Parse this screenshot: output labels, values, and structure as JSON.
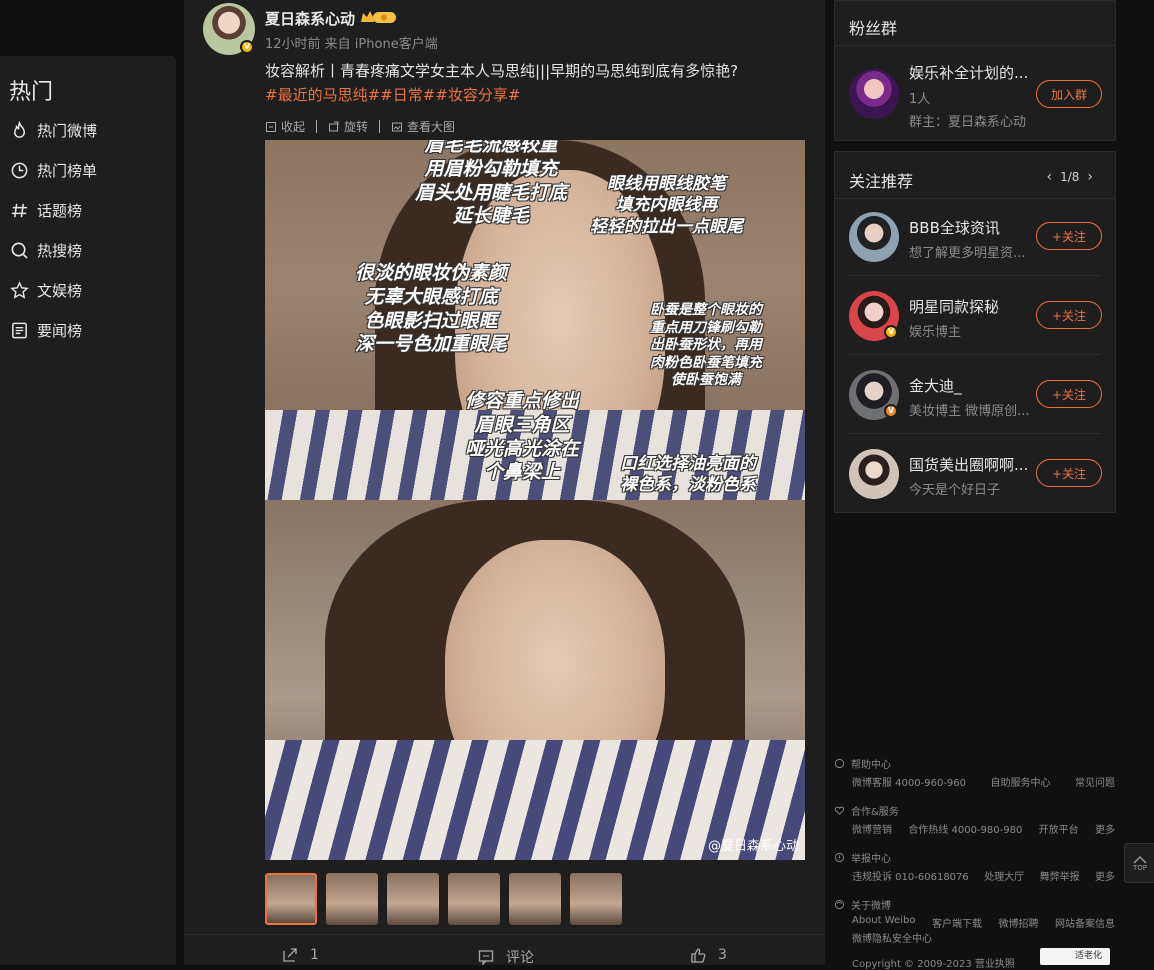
{
  "nav": {
    "title": "热门",
    "items": [
      {
        "label": "热门微博",
        "icon": "fire-icon"
      },
      {
        "label": "热门榜单",
        "icon": "clock-icon"
      },
      {
        "label": "话题榜",
        "icon": "hashtag-icon"
      },
      {
        "label": "热搜榜",
        "icon": "search-icon"
      },
      {
        "label": "文娱榜",
        "icon": "star-icon"
      },
      {
        "label": "要闻榜",
        "icon": "news-icon"
      }
    ]
  },
  "post": {
    "username": "夏日森系心动",
    "meta": "12小时前 来自 iPhone客户端",
    "text": "妆容解析丨青春疼痛文学女主本人马思纯|||早期的马思纯到底有多惊艳?",
    "tags": "#最近的马思纯##日常##妆容分享#",
    "toolbar": {
      "collapse": "收起",
      "rotate": "旋转",
      "view_large": "查看大图"
    },
    "image": {
      "annot1": "眉毛毛流感较重\n用眉粉勾勒填充\n眉头处用睫毛打底\n延长睫毛",
      "annot2": "眼线用眼线胶笔\n填充内眼线再\n轻轻的拉出一点眼尾",
      "annot3": "很淡的眼妆伪素颜\n无辜大眼感打底\n色眼影扫过眼眶\n深一号色加重眼尾",
      "annot4": "卧蚕是整个眼妆的\n重点用刀锋刷勾勒\n出卧蚕形状，再用\n肉粉色卧蚕笔填充\n使卧蚕饱满",
      "annot5": "修容重点修出\n眉眼三角区\n哑光高光涂在\n个鼻梁上",
      "annot6": "口红选择油亮面的\n裸色系，淡粉色系",
      "watermark": "@夏日森系心动"
    },
    "thumb_count": 6,
    "actions": {
      "share": "1",
      "comment": "评论",
      "like": "3"
    }
  },
  "fan_group": {
    "title": "粉丝群",
    "name": "娱乐补全计划的...",
    "count": "1人",
    "owner": "群主：夏日森系心动",
    "join": "加入群"
  },
  "recommend": {
    "title": "关注推荐",
    "page": "1/8",
    "follow_label": "+关注",
    "users": [
      {
        "name": "BBB全球资讯",
        "desc": "想了解更多明星资..."
      },
      {
        "name": "明星同款探秘",
        "desc": "娱乐博主"
      },
      {
        "name": "金大迪_",
        "desc": "美妆博主 微博原创..."
      },
      {
        "name": "国货美出圈啊啊...",
        "desc": "今天是个好日子"
      }
    ]
  },
  "footer": {
    "help": {
      "title": "帮助中心",
      "links": [
        "微博客服 4000-960-960",
        "自助服务中心",
        "常见问题"
      ]
    },
    "coop": {
      "title": "合作&服务",
      "links": [
        "微博营销",
        "合作热线 4000-980-980",
        "开放平台",
        "更多"
      ]
    },
    "report": {
      "title": "举报中心",
      "links": [
        "违规投诉 010-60618076",
        "处理大厅",
        "舞弊举报",
        "更多"
      ]
    },
    "about": {
      "title": "关于微博",
      "links": [
        "About Weibo",
        "客户端下载",
        "微博招聘",
        "网站备案信息"
      ],
      "extra": "微博隐私安全中心"
    },
    "copyright": "Copyright © 2009-2023 营业执照",
    "elder": "适老化"
  },
  "top_btn": "TOP"
}
